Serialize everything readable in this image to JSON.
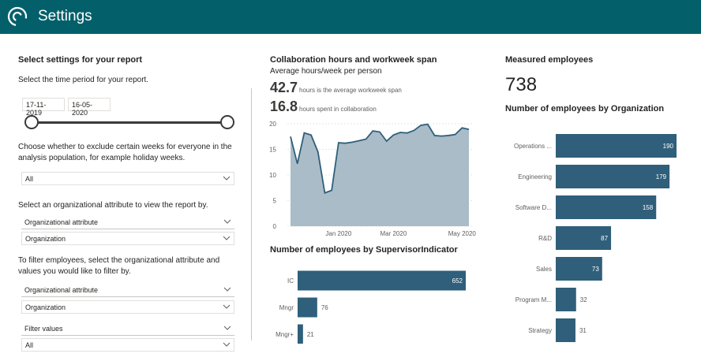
{
  "header": {
    "title": "Settings"
  },
  "settings": {
    "title": "Select settings for your report",
    "time_prompt": "Select the time period for your report.",
    "start_date": "17-11-2019",
    "end_date": "16-05-2020",
    "exclude_prompt_line1": "Choose whether to exclude certain weeks for everyone in the",
    "exclude_prompt_line2": "analysis population, for example holiday weeks.",
    "exclude_value": "All",
    "attr_prompt": "Select an organizational attribute to view the report by.",
    "attr_label": "Organizational attribute",
    "attr_value": "Organization",
    "filter_prompt_line1": "To filter employees, select the organizational attribute and",
    "filter_prompt_line2": "values you would like to filter by.",
    "filter_attr_label": "Organizational attribute",
    "filter_attr_value": "Organization",
    "filter_values_label": "Filter values",
    "filter_values_value": "All"
  },
  "collab": {
    "title": "Collaboration hours and workweek span",
    "subtitle": "Average hours/week per person",
    "kpi1_value": "42.7",
    "kpi1_label": "hours is the average workweek span",
    "kpi2_value": "16.8",
    "kpi2_label": "hours spent in collaboration"
  },
  "measured": {
    "title": "Measured employees",
    "value": "738"
  },
  "colors": {
    "header": "#03606b",
    "bar": "#2f5f7a",
    "area": "#a9bcc7",
    "line": "#2f5f7a"
  },
  "chart_data": [
    {
      "type": "area",
      "y_ticks": [
        0,
        5,
        10,
        15,
        20
      ],
      "x_tick_labels": [
        "Jan 2020",
        "Mar 2020",
        "May 2020"
      ],
      "ylim": [
        0,
        20
      ],
      "values": [
        17.5,
        12.2,
        18.2,
        17.8,
        14.5,
        6.5,
        7.0,
        16.3,
        16.2,
        16.4,
        16.7,
        17.0,
        18.6,
        18.4,
        16.6,
        17.8,
        18.3,
        18.2,
        18.7,
        19.7,
        19.9,
        17.7,
        17.6,
        17.7,
        17.9,
        19.2,
        18.9
      ]
    },
    {
      "type": "bar",
      "title": "Number of employees by SupervisorIndicator",
      "categories": [
        "IC",
        "Mngr",
        "Mngr+"
      ],
      "values": [
        652,
        76,
        21
      ]
    },
    {
      "type": "bar",
      "title": "Number of employees by Organization",
      "categories": [
        "Operations ...",
        "Engineering",
        "Software D...",
        "R&D",
        "Sales",
        "Program M...",
        "Strategy"
      ],
      "values": [
        190,
        179,
        158,
        87,
        73,
        32,
        31
      ]
    }
  ]
}
